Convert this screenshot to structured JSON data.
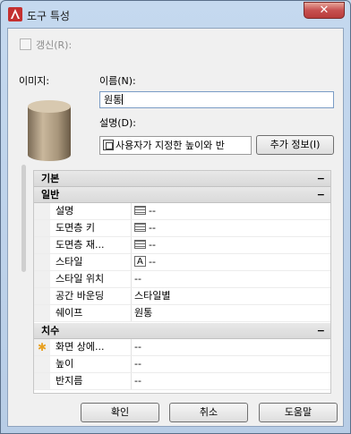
{
  "window": {
    "title": "도구 특성",
    "close_label": "✕"
  },
  "refresh": {
    "label": "갱신(R):",
    "checked": false
  },
  "image": {
    "label": "이미지:"
  },
  "name": {
    "label": "이름(N):",
    "value": "원통"
  },
  "description": {
    "label": "설명(D):",
    "value": "사용자가 지정한 높이와 반",
    "more_button": "추가 정보(I)"
  },
  "properties": {
    "basic": {
      "label": "기본",
      "toggle": "−"
    },
    "general": {
      "label": "일반",
      "toggle": "−",
      "rows": [
        {
          "name": "설명",
          "value": "--",
          "icon": "table-icon"
        },
        {
          "name": "도면층 키",
          "value": "--",
          "icon": "table-icon"
        },
        {
          "name": "도면층 재...",
          "value": "--",
          "icon": "table-icon"
        },
        {
          "name": "스타일",
          "value": "--",
          "icon": "style-icon"
        },
        {
          "name": "스타일 위치",
          "value": "--"
        },
        {
          "name": "공간 바운딩",
          "value": "스타일별"
        },
        {
          "name": "쉐이프",
          "value": "원통"
        }
      ]
    },
    "dimensions": {
      "label": "치수",
      "toggle": "−",
      "rows": [
        {
          "name": "화면 상에...",
          "value": "--",
          "starred": true
        },
        {
          "name": "높이",
          "value": "--"
        },
        {
          "name": "반지름",
          "value": "--"
        }
      ]
    }
  },
  "buttons": {
    "ok": "확인",
    "cancel": "취소",
    "help": "도움말"
  },
  "colors": {
    "accent": "#c75050",
    "star": "#e8a020"
  }
}
